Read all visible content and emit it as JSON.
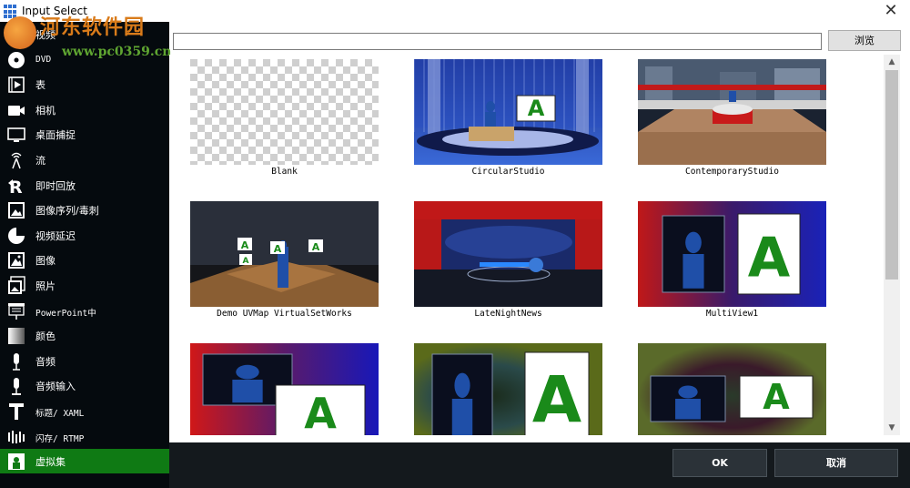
{
  "window": {
    "title": "Input Select",
    "close_glyph": "✕"
  },
  "watermark": {
    "title": "河东软件园",
    "url": "www.pc0359.cn"
  },
  "sidebar": {
    "items": [
      {
        "label": "视频",
        "icon": "video-file-icon",
        "mono": false
      },
      {
        "label": "DVD",
        "icon": "dvd-icon",
        "mono": true
      },
      {
        "label": "表",
        "icon": "list-play-icon",
        "mono": false
      },
      {
        "label": "相机",
        "icon": "camera-icon",
        "mono": false
      },
      {
        "label": "桌面捕捉",
        "icon": "monitor-icon",
        "mono": false
      },
      {
        "label": "流",
        "icon": "stream-antenna-icon",
        "mono": false
      },
      {
        "label": "即时回放",
        "icon": "replay-icon",
        "mono": false
      },
      {
        "label": "图像序列/毒刺",
        "icon": "image-sequence-icon",
        "mono": false
      },
      {
        "label": "视频延迟",
        "icon": "clock-delay-icon",
        "mono": false
      },
      {
        "label": "图像",
        "icon": "image-icon",
        "mono": false
      },
      {
        "label": "照片",
        "icon": "photos-icon",
        "mono": false
      },
      {
        "label": "PowerPoint中",
        "icon": "presentation-icon",
        "mono": true
      },
      {
        "label": "颜色",
        "icon": "color-gradient-icon",
        "mono": false
      },
      {
        "label": "音频",
        "icon": "microphone-icon",
        "mono": false
      },
      {
        "label": "音频输入",
        "icon": "microphone-input-icon",
        "mono": false
      },
      {
        "label": "标题/ XAML",
        "icon": "title-text-icon",
        "mono": true
      },
      {
        "label": "闪存/ RTMP",
        "icon": "flash-rtmp-icon",
        "mono": true
      },
      {
        "label": "虚拟集",
        "icon": "virtual-set-icon",
        "mono": false,
        "active": true
      }
    ]
  },
  "path_bar": {
    "value": "",
    "browse_label": "浏览"
  },
  "gallery": {
    "items": [
      {
        "label": "Blank",
        "kind": "blank"
      },
      {
        "label": "CircularStudio",
        "kind": "circular"
      },
      {
        "label": "ContemporaryStudio",
        "kind": "contemporary"
      },
      {
        "label": "Demo UVMap VirtualSetWorks",
        "kind": "demo"
      },
      {
        "label": "LateNightNews",
        "kind": "latenight"
      },
      {
        "label": "MultiView1",
        "kind": "multiview1"
      },
      {
        "label": "",
        "kind": "multiview2"
      },
      {
        "label": "",
        "kind": "multiview3"
      },
      {
        "label": "",
        "kind": "multiview4"
      }
    ],
    "letter": "A"
  },
  "scrollbar": {
    "up_glyph": "▲",
    "down_glyph": "▼"
  },
  "footer": {
    "ok_label": "OK",
    "cancel_label": "取消"
  },
  "colors": {
    "sidebar_bg": "#050a0e",
    "active_item": "#0f7a14",
    "footer_bg": "#14191d",
    "letter_green": "#1a8a1a"
  }
}
